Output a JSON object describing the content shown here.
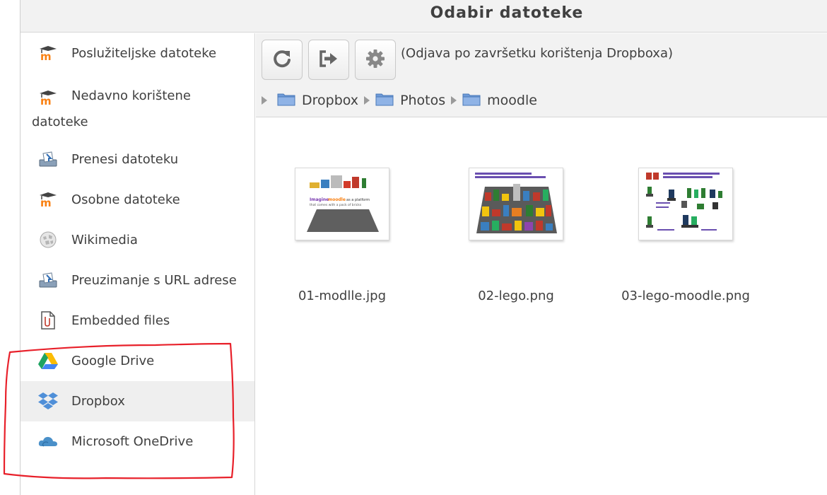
{
  "dialog": {
    "title": "Odabir datoteke"
  },
  "sidebar": {
    "items": [
      {
        "label": "Poslužiteljske datoteke",
        "icon": "moodle-icon"
      },
      {
        "label_line1": "Nedavno korištene",
        "label_line2": "datoteke",
        "icon": "moodle-icon"
      },
      {
        "label": "Prenesi datoteku",
        "icon": "upload-icon"
      },
      {
        "label": "Osobne datoteke",
        "icon": "moodle-icon"
      },
      {
        "label": "Wikimedia",
        "icon": "wikimedia-icon"
      },
      {
        "label": "Preuzimanje s URL adrese",
        "icon": "url-download-icon"
      },
      {
        "label": "Embedded files",
        "icon": "embedded-files-icon"
      },
      {
        "label": "Google Drive",
        "icon": "google-drive-icon"
      },
      {
        "label": "Dropbox",
        "icon": "dropbox-icon",
        "selected": true
      },
      {
        "label": "Microsoft OneDrive",
        "icon": "onedrive-icon"
      }
    ]
  },
  "toolbar": {
    "refresh_icon": "refresh-icon",
    "logout_icon": "logout-icon",
    "settings_icon": "gear-icon",
    "logout_text": "(Odjava po završetku korištenja Dropboxa)"
  },
  "breadcrumb": [
    "Dropbox",
    "Photos",
    "moodle"
  ],
  "files": [
    {
      "name": "01-modlle.jpg"
    },
    {
      "name": "02-lego.png"
    },
    {
      "name": "03-lego-moodle.png"
    }
  ],
  "colors": {
    "moodle_orange": "#f98012",
    "annotation_red": "#e8202a",
    "folder_blue": "#6f9bd8"
  }
}
